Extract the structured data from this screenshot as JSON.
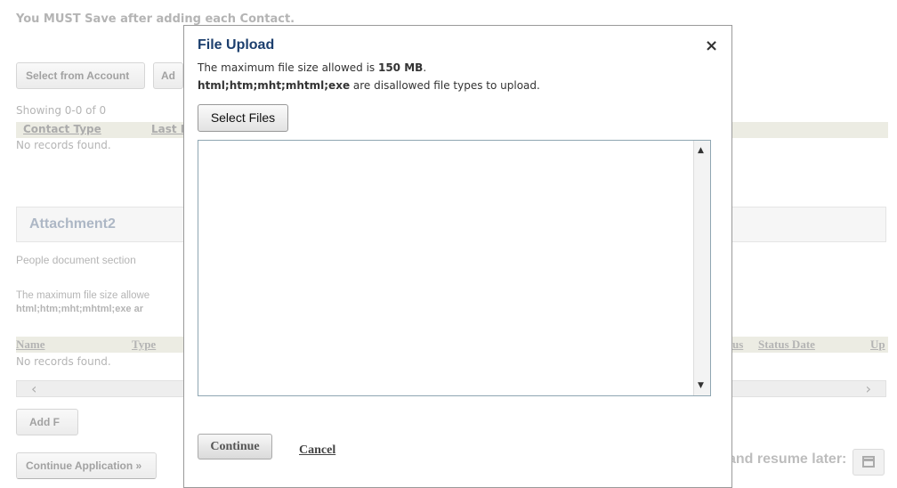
{
  "background": {
    "notice": "You MUST Save after adding each Contact.",
    "buttons": {
      "select_from_account": "Select from Account",
      "add_partial": "Ad",
      "add_file_partial": "Add F",
      "continue_application": "Continue Application »"
    },
    "contacts": {
      "showing": "Showing 0-0 of 0",
      "columns": [
        "Contact Type",
        "Last Na"
      ],
      "no_records": "No records found."
    },
    "attachment": {
      "title": "Attachment2",
      "description": "People document section",
      "max_size_partial": "The maximum file size allowe",
      "types_partial": "html;htm;mht;mhtml;exe ar",
      "columns": [
        "Name",
        "Type",
        "us",
        "Status Date",
        "Up"
      ],
      "no_records": "No records found."
    },
    "resume_text": "and resume later:",
    "icons": {
      "scroll_left": "‹",
      "scroll_right": "›",
      "save": "floppy-disk-icon"
    }
  },
  "modal": {
    "title": "File Upload",
    "close_glyph": "×",
    "max_prefix": "The maximum file size allowed is ",
    "max_value": "150 MB",
    "max_suffix": ".",
    "types_bold": "html;htm;mht;mhtml;exe",
    "types_rest": " are disallowed file types to upload.",
    "select_files": "Select Files",
    "continue": "Continue",
    "cancel": "Cancel"
  }
}
